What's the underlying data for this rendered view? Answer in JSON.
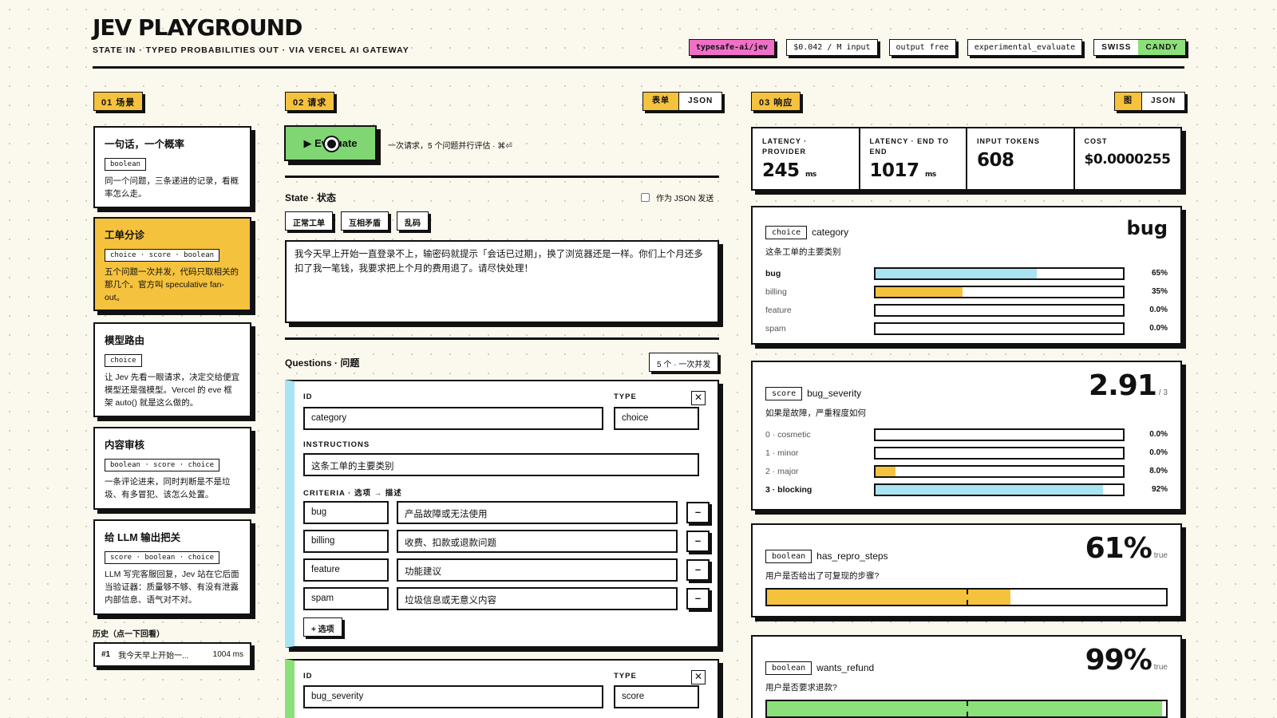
{
  "header": {
    "title": "JEV PLAYGROUND",
    "subtitle": "STATE IN · TYPED PROBABILITIES OUT · VIA VERCEL AI GATEWAY",
    "chips": [
      "typesafe-ai/jev",
      "$0.042 / M input",
      "output free",
      "experimental_evaluate"
    ],
    "theme": {
      "swiss": "SWISS",
      "candy": "CANDY"
    }
  },
  "scenarios": {
    "tag": "01 场景",
    "items": [
      {
        "title": "一句话，一个概率",
        "types": "boolean",
        "desc": "同一个问题，三条递进的记录，看概率怎么走。"
      },
      {
        "title": "工单分诊",
        "types": "choice · score · boolean",
        "desc": "五个问题一次并发，代码只取相关的那几个。官方叫 speculative fan-out。"
      },
      {
        "title": "模型路由",
        "types": "choice",
        "desc": "让 Jev 先看一眼请求，决定交给便宜模型还是强模型。Vercel 的 eve 框架 auto() 就是这么做的。"
      },
      {
        "title": "内容审核",
        "types": "boolean · score · choice",
        "desc": "一条评论进来，同时判断是不是垃圾、有多冒犯、该怎么处置。"
      },
      {
        "title": "给 LLM 输出把关",
        "types": "score · boolean · choice",
        "desc": "LLM 写完客服回复，Jev 站在它后面当验证器：质量够不够、有没有泄露内部信息、语气对不对。"
      }
    ],
    "history_label": "历史（点一下回看）",
    "history": [
      {
        "num": "#1",
        "text": "我今天早上开始一...",
        "ms": "1004 ms"
      }
    ]
  },
  "request": {
    "tag": "02 请求",
    "toggle": {
      "form": "表单",
      "json": "JSON"
    },
    "evaluate": "▶ Evaluate",
    "hint": "一次请求，5 个问题并行评估 · ⌘⏎",
    "state_label": "State · 状态",
    "send_json": "作为 JSON 发送",
    "presets": [
      "正常工单",
      "互相矛盾",
      "乱码"
    ],
    "state_text": "我今天早上开始一直登录不上，输密码就提示「会话已过期」，换了浏览器还是一样。你们上个月还多扣了我一笔钱，我要求把上个月的费用退了。请尽快处理！",
    "questions_label": "Questions · 问题",
    "questions_count": "5 个 · 一次并发",
    "labels": {
      "id": "ID",
      "type": "TYPE",
      "instructions": "INSTRUCTIONS",
      "criteria": "CRITERIA · 选项 → 描述",
      "add": "+ 选项"
    },
    "questions": [
      {
        "id": "category",
        "type": "choice",
        "instructions": "这条工单的主要类别",
        "criteria": [
          {
            "key": "bug",
            "desc": "产品故障或无法使用"
          },
          {
            "key": "billing",
            "desc": "收费、扣款或退款问题"
          },
          {
            "key": "feature",
            "desc": "功能建议"
          },
          {
            "key": "spam",
            "desc": "垃圾信息或无意义内容"
          }
        ]
      },
      {
        "id": "bug_severity",
        "type": "score"
      }
    ]
  },
  "response": {
    "tag": "03 响应",
    "toggle": {
      "chart": "图",
      "json": "JSON"
    },
    "metrics": [
      {
        "label": "LATENCY · PROVIDER",
        "value": "245",
        "unit": "ms"
      },
      {
        "label": "LATENCY · END TO END",
        "value": "1017",
        "unit": "ms"
      },
      {
        "label": "INPUT TOKENS",
        "value": "608",
        "unit": ""
      },
      {
        "label": "COST",
        "value": "$0.0000255",
        "unit": ""
      }
    ],
    "results": [
      {
        "kind": "choice",
        "name": "category",
        "answer": "bug",
        "desc": "这条工单的主要类别",
        "bars": [
          {
            "label": "bug",
            "pct": "65%",
            "value": 0.65,
            "color": "#a8e4f2",
            "bold": true
          },
          {
            "label": "billing",
            "pct": "35%",
            "value": 0.35,
            "color": "#f5c23d",
            "bold": false
          },
          {
            "label": "feature",
            "pct": "0.0%",
            "value": 0,
            "color": "#a8e4f2",
            "bold": false
          },
          {
            "label": "spam",
            "pct": "0.0%",
            "value": 0,
            "color": "#a8e4f2",
            "bold": false
          }
        ]
      },
      {
        "kind": "score",
        "name": "bug_severity",
        "answer": "2.91",
        "scale": "/ 3",
        "desc": "如果是故障，严重程度如何",
        "bars": [
          {
            "label": "0 · cosmetic",
            "pct": "0.0%",
            "value": 0,
            "color": "#a8e4f2",
            "bold": false
          },
          {
            "label": "1 · minor",
            "pct": "0.0%",
            "value": 0,
            "color": "#a8e4f2",
            "bold": false
          },
          {
            "label": "2 · major",
            "pct": "8.0%",
            "value": 0.08,
            "color": "#f5c23d",
            "bold": false
          },
          {
            "label": "3 · blocking",
            "pct": "92%",
            "value": 0.92,
            "color": "#a8e4f2",
            "bold": true
          }
        ]
      },
      {
        "kind": "boolean",
        "name": "has_repro_steps",
        "answer": "61%",
        "sub": "true",
        "desc": "用户是否给出了可复现的步骤?",
        "value": 0.61,
        "color": "#f5c23d"
      },
      {
        "kind": "boolean",
        "name": "wants_refund",
        "answer": "99%",
        "sub": "true",
        "desc": "用户是否要求退款?",
        "value": 0.99,
        "color": "#8ce07a"
      }
    ]
  }
}
